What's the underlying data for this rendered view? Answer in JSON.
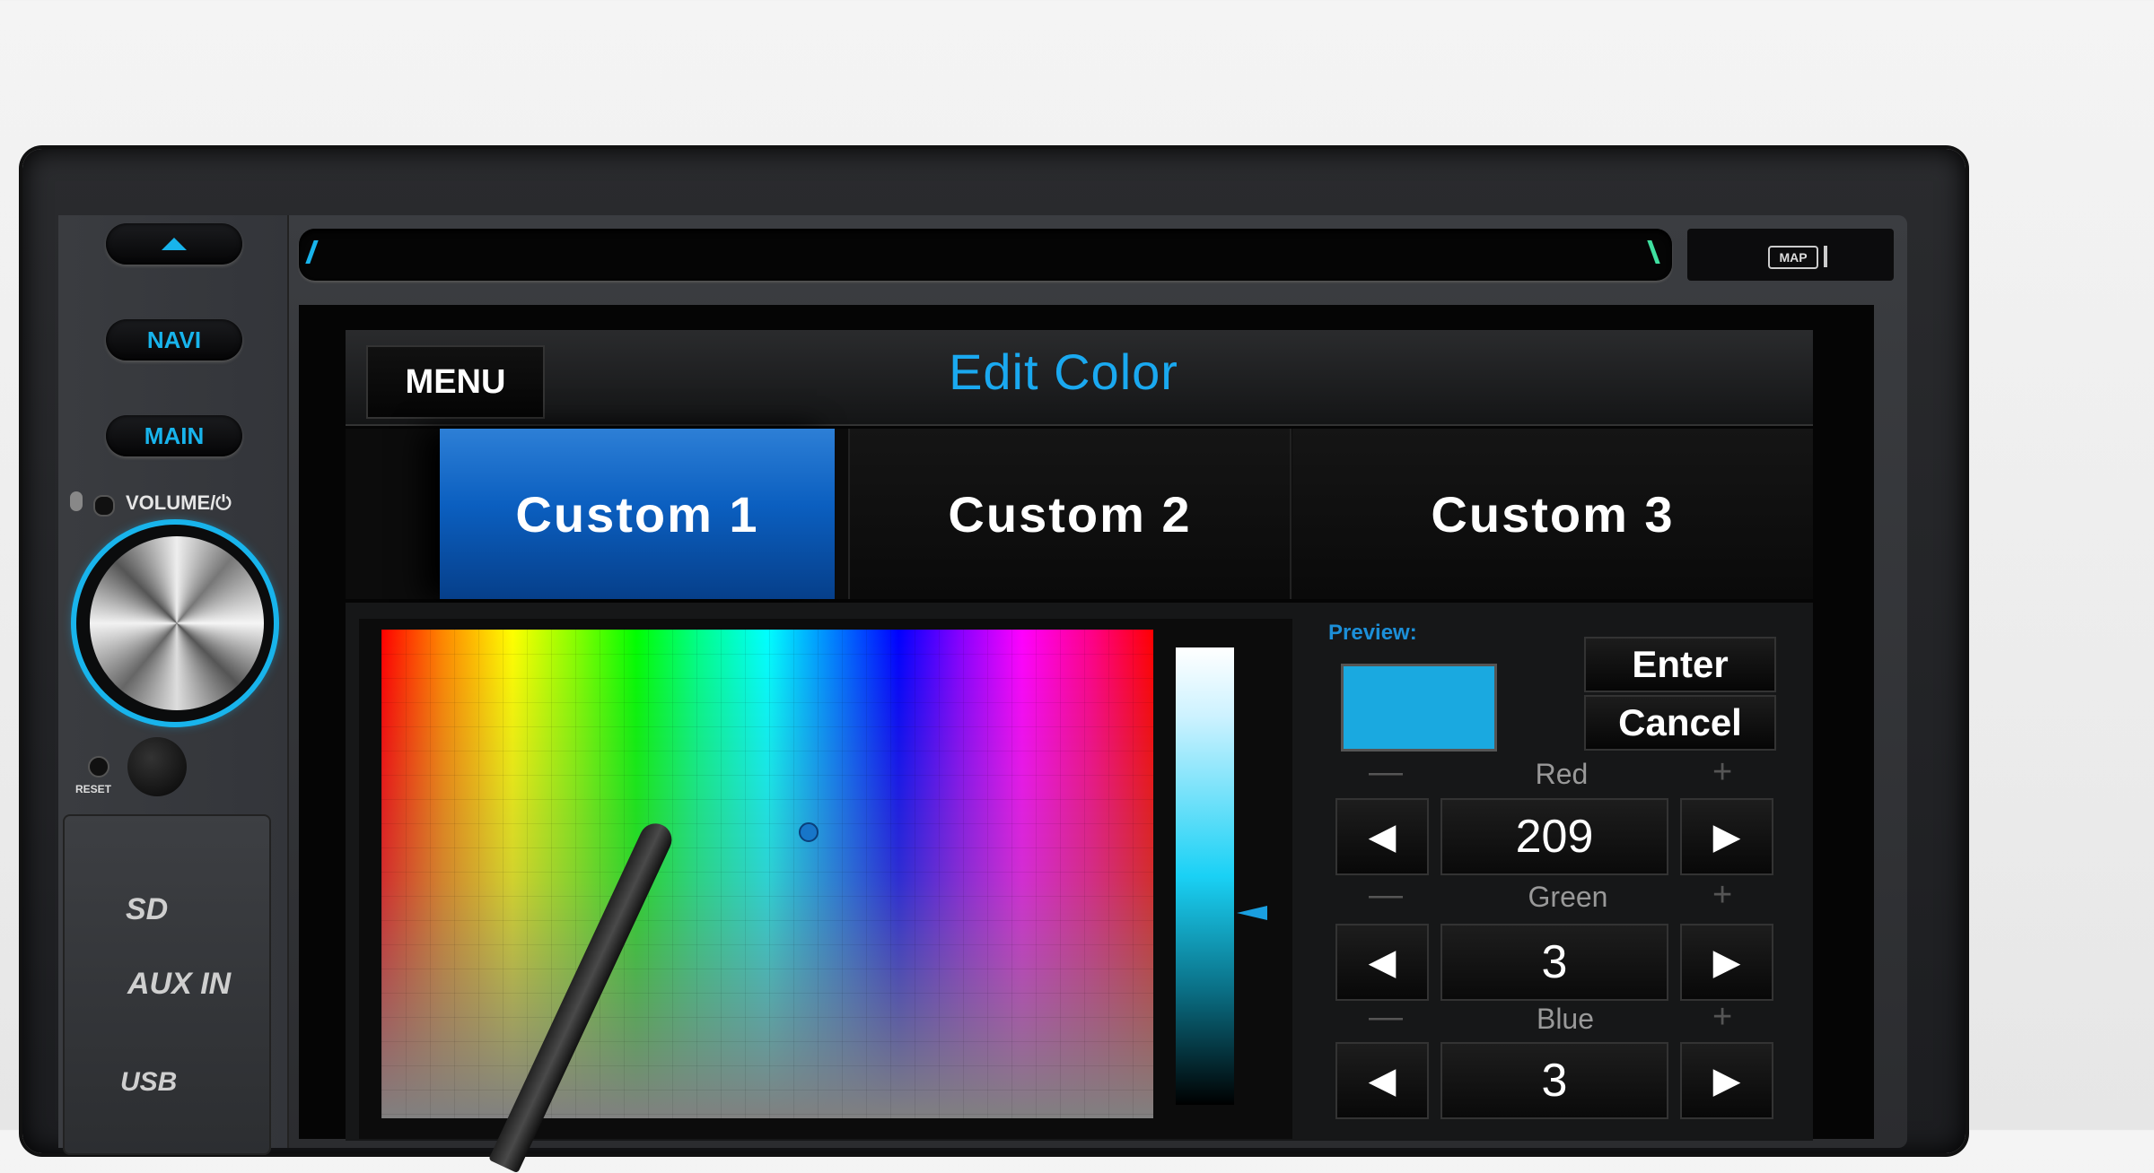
{
  "hardware": {
    "navi_label": "NAVI",
    "main_label": "MAIN",
    "volume_label": "VOLUME/⏻",
    "reset_label": "RESET",
    "sd_label": "SD",
    "aux_label": "AUX IN",
    "usb_label": "USB",
    "map_label": "MAP",
    "eject_icon": "eject-icon"
  },
  "screen": {
    "menu_label": "MENU",
    "title": "Edit Color",
    "tabs": [
      {
        "label": "Custom 1",
        "active": true
      },
      {
        "label": "Custom 2",
        "active": false
      },
      {
        "label": "Custom 3",
        "active": false
      }
    ],
    "preview_label": "Preview:",
    "preview_color": "#1aa9e0",
    "enter_label": "Enter",
    "cancel_label": "Cancel",
    "channels": [
      {
        "name": "Red",
        "value": "209"
      },
      {
        "name": "Green",
        "value": "3"
      },
      {
        "name": "Blue",
        "value": "3"
      }
    ],
    "minus_symbol": "—",
    "plus_symbol": "+",
    "left_arrow": "◀",
    "right_arrow": "▶"
  },
  "colors": {
    "accent": "#18b4ec",
    "title_blue": "#1aa9f0",
    "active_tab": "#0b5fc0"
  }
}
